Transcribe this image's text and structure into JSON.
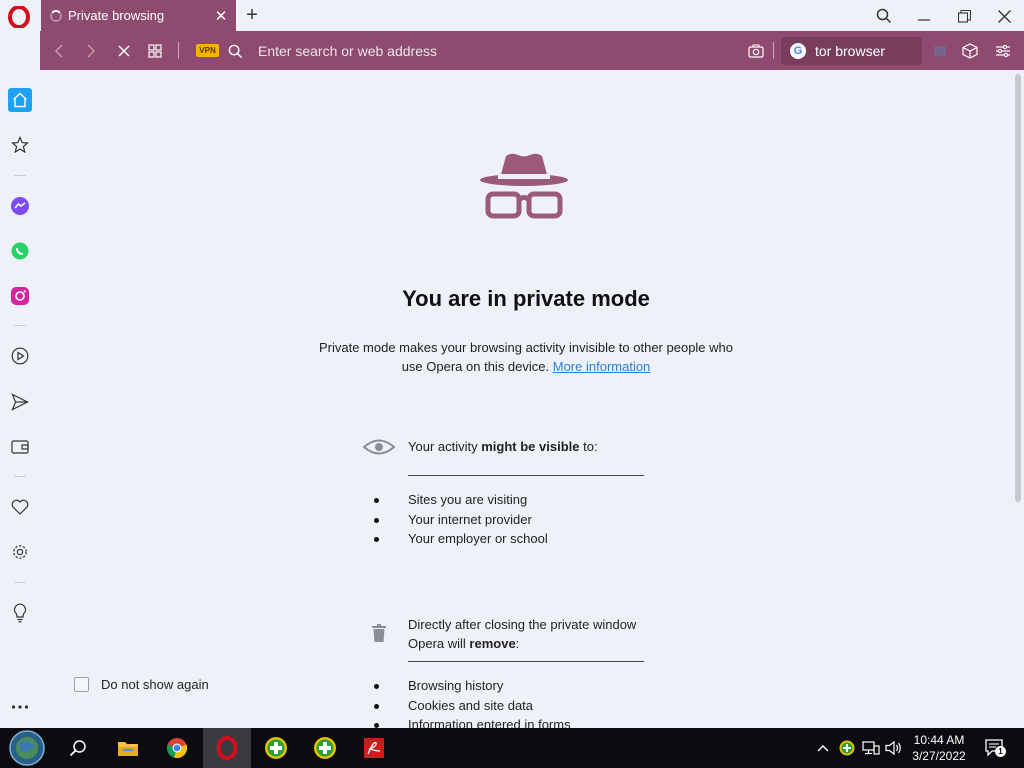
{
  "browser": {
    "tab_title": "Private browsing",
    "url_placeholder": "Enter search or web address",
    "vpn_label": "VPN",
    "search_engine_letter": "G",
    "search_text": "tor browser"
  },
  "page": {
    "title": "You are in private mode",
    "description": "Private mode makes your browsing activity invisible to other people who use Opera on this device.",
    "more_info_link": "More information",
    "visible_section": {
      "prefix": "Your activity ",
      "bold": "might be visible",
      "suffix": " to:"
    },
    "visible_items": [
      "Sites you are visiting",
      "Your internet provider",
      "Your employer or school"
    ],
    "remove_section": {
      "line1": "Directly after closing the private window",
      "line2_prefix": "Opera will ",
      "line2_bold": "remove",
      "line2_suffix": ":"
    },
    "remove_items": [
      "Browsing history",
      "Cookies and site data",
      "Information entered in forms"
    ],
    "dont_show_label": "Do not show again"
  },
  "taskbar": {
    "time": "10:44 AM",
    "date": "3/27/2022",
    "notification_count": "1"
  },
  "colors": {
    "brand": "#8e4a6f",
    "accent_blue": "#1ea1f2",
    "opera_red": "#d10e1e"
  }
}
